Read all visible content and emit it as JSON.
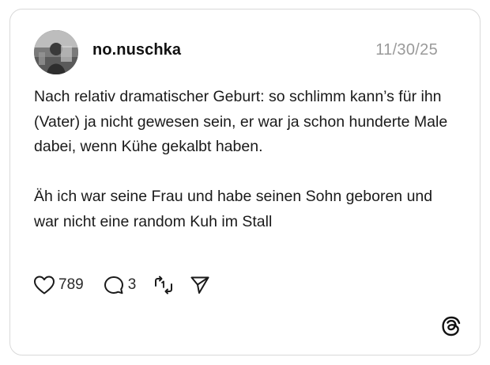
{
  "post": {
    "username": "no.nuschka",
    "date": "11/30/25",
    "paragraphs": [
      "Nach relativ dramatischer Geburt: so schlimm kann’s für ihn (Vater) ja nicht gewesen sein, er war ja schon hunderte Male dabei, wenn Kühe gekalbt haben.",
      "Äh ich war seine Frau und habe seinen Sohn geboren und war nicht eine random Kuh im Stall"
    ]
  },
  "actions": {
    "likes": "789",
    "replies": "3",
    "like_icon": "heart-icon",
    "reply_icon": "speech-bubble-icon",
    "repost_icon": "repost-icon",
    "share_icon": "send-icon"
  },
  "brand": {
    "logo": "threads-logo-icon"
  },
  "colors": {
    "text": "#1a1a1a",
    "muted": "#9a9a9a",
    "border": "#d9d9d9",
    "background": "#ffffff"
  }
}
